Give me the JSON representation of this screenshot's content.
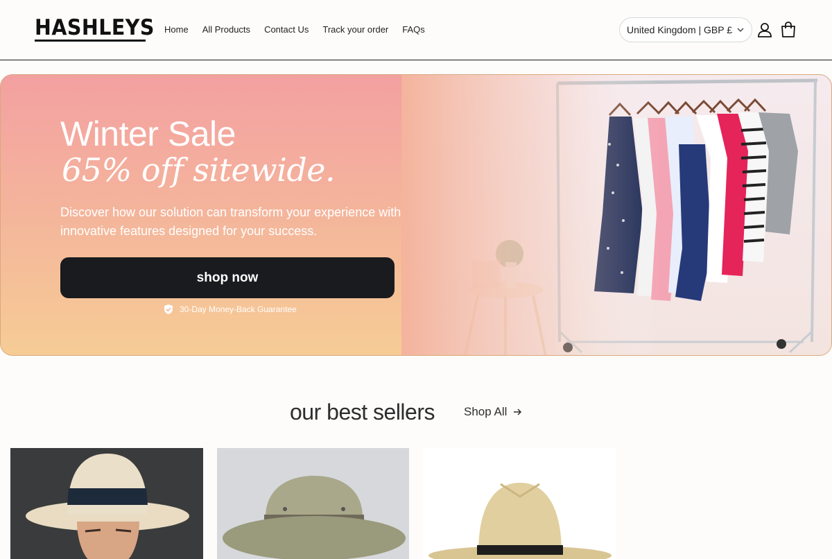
{
  "header": {
    "logo": "HASHLEYS",
    "nav": [
      "Home",
      "All Products",
      "Contact Us",
      "Track your order",
      "FAQs"
    ],
    "country_selector": "United Kingdom | GBP £",
    "icons": [
      "chevron-down-icon",
      "account-icon",
      "cart-icon"
    ]
  },
  "hero": {
    "title": "Winter Sale",
    "subtitle": "65% off sitewide.",
    "description": "Discover how our solution can transform your experience with innovative features designed for your success.",
    "cta": "shop now",
    "guarantee": "30-Day Money-Back Guarantee"
  },
  "best_sellers": {
    "title": "our best sellers",
    "shop_all": "Shop All",
    "products": [
      "panama-hat",
      "bucket-hat",
      "straw-fedora"
    ]
  },
  "colors": {
    "accent_dark": "#191b1e",
    "hero_pink": "#f3a0a1",
    "hero_peach": "#f6cc95"
  }
}
